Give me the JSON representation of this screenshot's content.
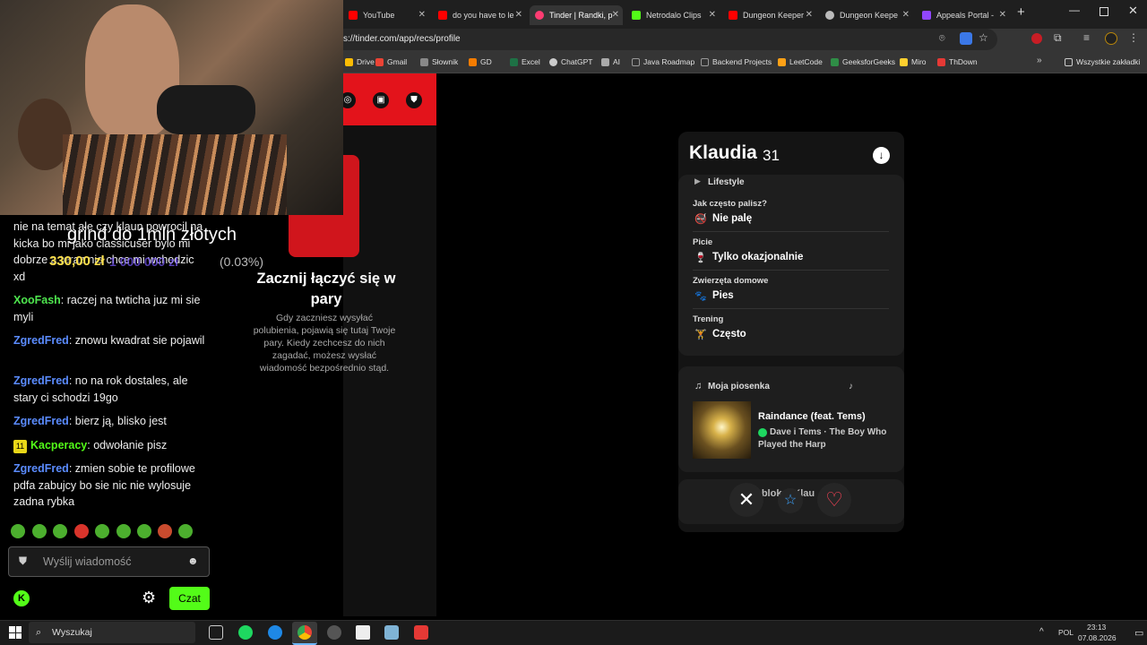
{
  "browser": {
    "tabs": [
      {
        "title": "YouTube",
        "color": "#ff0000"
      },
      {
        "title": "do you have to le",
        "color": "#ff0000"
      },
      {
        "title": "Tinder | Randki, p",
        "color": "#fe3c72"
      },
      {
        "title": "Netrodalo Clips",
        "color": "#53fc18"
      },
      {
        "title": "Dungeon Keeper",
        "color": "#ff0000"
      },
      {
        "title": "Dungeon Keepe",
        "color": "#bbbbbb"
      },
      {
        "title": "Appeals Portal -",
        "color": "#9146ff"
      }
    ],
    "new_tab": "+",
    "url": "s://tinder.com/app/recs/profile",
    "bookmarks": [
      {
        "label": "Drive",
        "color": "#fbbc04"
      },
      {
        "label": "Gmail",
        "color": "#ea4335"
      },
      {
        "label": "Słownik",
        "color": "#888888"
      },
      {
        "label": "GD",
        "color": "#f57c00"
      },
      {
        "label": "Excel",
        "color": "#1e7145"
      },
      {
        "label": "ChatGPT",
        "color": "#cccccc"
      },
      {
        "label": "AI",
        "color": "#aaaaaa"
      },
      {
        "label": "Java Roadmap",
        "color": "#333333"
      },
      {
        "label": "Backend Projects",
        "color": "#333333"
      },
      {
        "label": "LeetCode",
        "color": "#ffa116"
      },
      {
        "label": "GeeksforGeeks",
        "color": "#2f8d46"
      },
      {
        "label": "Miro",
        "color": "#ffd02f"
      },
      {
        "label": "ThDown",
        "color": "#e53935"
      }
    ],
    "all_bookmarks": "Wszystkie zakładki"
  },
  "tinder": {
    "empty_title": "Zacznij łączyć się w pary",
    "empty_text": "Gdy zaczniesz wysyłać polubienia, pojawią się tutaj Twoje pary. Kiedy zechcesz do nich zagadać, możesz wysłać wiadomość bezpośrednio stąd.",
    "profile": {
      "name": "Klaudia",
      "age": "31",
      "lifestyle_heading": "Lifestyle",
      "rows": [
        {
          "label": "Jak często palisz?",
          "value": "Nie palę",
          "icon": "🚭"
        },
        {
          "label": "Picie",
          "value": "Tylko okazjonalnie",
          "icon": "🍷"
        },
        {
          "label": "Zwierzęta domowe",
          "value": "Pies",
          "icon": "🐾"
        },
        {
          "label": "Trening",
          "value": "Często",
          "icon": "🏋"
        }
      ],
      "song_heading": "Moja piosenka",
      "song_title": "Raindance (feat. Tems)",
      "song_artist": "Dave i Tems",
      "song_album": "The Boy Who Played the Harp",
      "blocked_text": "Zablokuj Klau"
    },
    "actions": {
      "nope": "✕",
      "superlike": "☆",
      "like": "♡"
    }
  },
  "stream": {
    "overlay_title": "grind do 1mln złotych",
    "amount": "330,00 zł",
    "goal_partial": "1 000 000 zł",
    "percent": "(0.03%)",
    "messages": [
      {
        "user": "",
        "text": "nie na temat ale czy klaun powrocil na kicka bo mi jako classicuser bylo mi dobrze a teraz nie chce mi wchodzic xd",
        "color": "#ffffff"
      },
      {
        "user": "XooFash",
        "text": ": raczej na twticha juz mi sie myli",
        "color": "#4ee54e"
      },
      {
        "user": "ZgredFred",
        "text": ": znowu kwadrat sie pojawil",
        "color": "#5b8cff"
      },
      {
        "user": "ZgredFred",
        "text": ": no na rok dostales, ale stary ci schodzi 19go",
        "color": "#5b8cff"
      },
      {
        "user": "ZgredFred",
        "text": ": bierz ją, blisko jest",
        "color": "#5b8cff"
      },
      {
        "user": "Kacperacy",
        "text": ": odwołanie pisz",
        "color": "#53fc18",
        "badge": "11"
      },
      {
        "user": "ZgredFred",
        "text": ": zmien sobie te profilowe pdfa zabujcy bo sie nic nie wylosuje zadna rybka",
        "color": "#5b8cff"
      }
    ],
    "input_placeholder": "Wyślij wiadomość",
    "chat_button": "Czat"
  },
  "taskbar": {
    "search": "Wyszukaj",
    "lang": "POL",
    "time": "23:13",
    "date": "07.08.2026"
  }
}
